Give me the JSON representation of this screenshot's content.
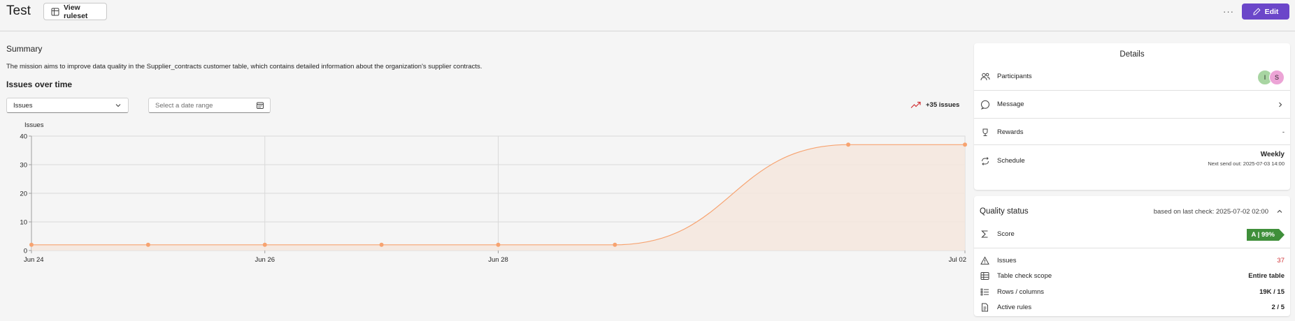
{
  "header": {
    "title": "Test",
    "view_ruleset_label": "View ruleset",
    "more_label": "···",
    "edit_label": "Edit"
  },
  "summary": {
    "title": "Summary",
    "text": "The mission aims to improve data quality in the Supplier_contracts customer table, which contains detailed information about the organization's supplier contracts."
  },
  "issues_over_time": {
    "title": "Issues over time",
    "metric_select_value": "Issues",
    "date_range_placeholder": "Select a date range",
    "trend_label": "+35 issues",
    "trend_color": "#d13438"
  },
  "chart_data": {
    "type": "area",
    "ylabel": "Issues",
    "ylim": [
      0,
      40
    ],
    "yticks": [
      0,
      10,
      20,
      30,
      40
    ],
    "x_tick_labels": [
      "Jun 24",
      "Jun 26",
      "Jun 28",
      "Jul 02"
    ],
    "series": [
      {
        "points": [
          {
            "x": "2025-06-24",
            "y": 2
          },
          {
            "x": "2025-06-25",
            "y": 2
          },
          {
            "x": "2025-06-26",
            "y": 2
          },
          {
            "x": "2025-06-27",
            "y": 2
          },
          {
            "x": "2025-06-28",
            "y": 2
          },
          {
            "x": "2025-06-29",
            "y": 2
          },
          {
            "x": "2025-07-01",
            "y": 37
          },
          {
            "x": "2025-07-02",
            "y": 37
          }
        ]
      }
    ],
    "line_color": "#f7a370",
    "fill_color": "#f4e6dd",
    "grid": true
  },
  "details": {
    "title": "Details",
    "participants_label": "Participants",
    "participants": [
      {
        "initial": "I",
        "color": "#a8d5a2"
      },
      {
        "initial": "S",
        "color": "#eca4d6"
      }
    ],
    "message_label": "Message",
    "rewards_label": "Rewards",
    "rewards_value": "-",
    "schedule_label": "Schedule",
    "schedule_value": "Weekly",
    "schedule_next": "Next send out: 2025-07-03 14:00"
  },
  "quality_status": {
    "title": "Quality status",
    "based_on": "based on last check: 2025-07-02 02:00",
    "score_label": "Score",
    "score_value": "A | 99%",
    "score_color": "#3f8f3a",
    "issues_label": "Issues",
    "issues_value": "37",
    "issues_color": "#d13438",
    "scope_label": "Table check scope",
    "scope_value": "Entire table",
    "rows_label": "Rows / columns",
    "rows_value": "19K / 15",
    "rules_label": "Active rules",
    "rules_value": "2 / 5"
  }
}
